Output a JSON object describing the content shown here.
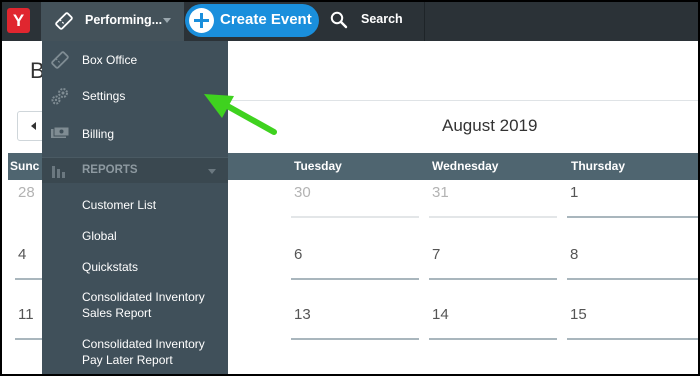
{
  "topbar": {
    "logo_text": "Y",
    "performing_label": "Performing...",
    "create_event_label": "Create Event",
    "search_label": "Search"
  },
  "page": {
    "heading_partial": "B",
    "month_title": "August 2019"
  },
  "calendar": {
    "weekdays": [
      "Sunc",
      "Tuesday",
      "Wednesday",
      "Thursday"
    ],
    "rows": [
      [
        "28",
        "30",
        "31",
        "1"
      ],
      [
        "4",
        "6",
        "7",
        "8"
      ],
      [
        "11",
        "13",
        "14",
        "15"
      ]
    ]
  },
  "menu": {
    "items": [
      {
        "label": "Box Office",
        "icon": "ticket-icon"
      },
      {
        "label": "Settings",
        "icon": "gears-icon"
      },
      {
        "label": "Billing",
        "icon": "money-icon"
      }
    ],
    "section_label": "REPORTS",
    "section_icon": "bar-chart-icon",
    "reports": [
      "Customer List",
      "Global",
      "Quickstats",
      "Consolidated Inventory Sales Report",
      "Consolidated Inventory Pay Later Report"
    ]
  },
  "colors": {
    "topbar": "#2b3237",
    "menu": "#40505a",
    "accent_blue": "#1a8fdc",
    "logo_red": "#e0262f",
    "calendar_header": "#4f6570",
    "arrow_green": "#3fd21f"
  }
}
